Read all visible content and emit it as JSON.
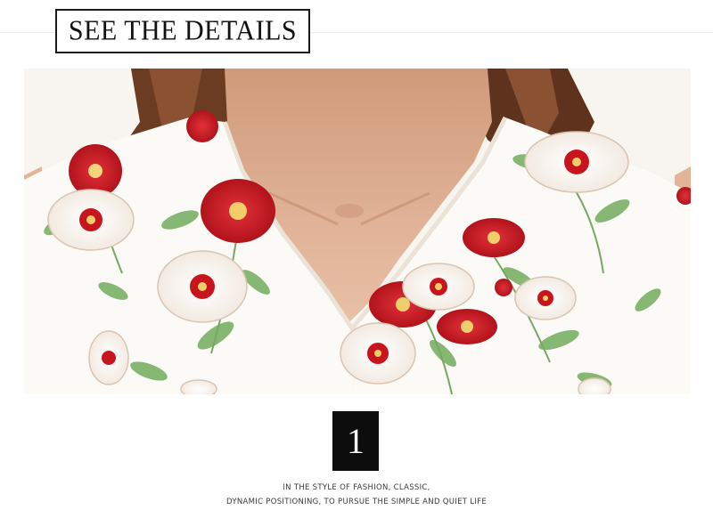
{
  "header": {
    "title": "SEE THE DETAILS"
  },
  "photo": {
    "subject": "floral-print-v-neck-dress-detail"
  },
  "detail": {
    "number": "1",
    "caption_line1": "IN THE STYLE OF FASHION, CLASSIC,",
    "caption_line2": "DYNAMIC POSITIONING, TO PURSUE THE SIMPLE AND QUIET LIFE"
  },
  "colors": {
    "badge_bg": "#0d0d0d",
    "heading_border": "#1a1a1a",
    "flower_red": "#c8141c",
    "leaf_green": "#7fb36a",
    "skin": "#d9a88a",
    "hair": "#6b3b22"
  }
}
